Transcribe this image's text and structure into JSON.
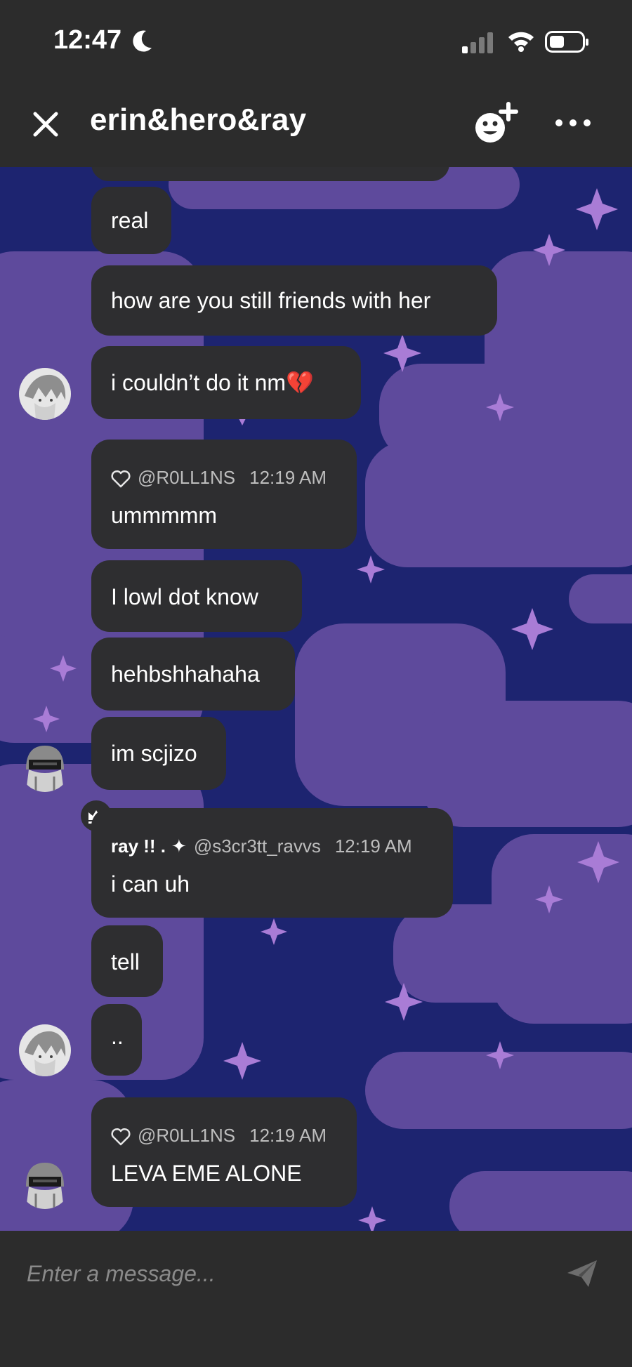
{
  "status_bar": {
    "time": "12:47"
  },
  "header": {
    "title": "erin&hero&ray"
  },
  "messages": [
    {
      "text": "real"
    },
    {
      "text": "how are you still friends with her"
    },
    {
      "text": "i couldn’t do it nm💔"
    },
    {
      "reply_to": "@R0LL1NS",
      "reply_time": "12:19 AM",
      "text": "ummmmm"
    },
    {
      "text": "I lowl dot know"
    },
    {
      "text": "hehbshhahaha"
    },
    {
      "text": "im scjizo"
    },
    {
      "sender_name": "ray !! .",
      "sender_badge": "✦",
      "sender_handle": "@s3cr3tt_ravvs",
      "time": "12:19 AM",
      "text": "i can uh"
    },
    {
      "text": "tell"
    },
    {
      "text": ".."
    },
    {
      "reply_to": "@R0LL1NS",
      "reply_time": "12:19 AM",
      "text": "LEVA EME ALONE"
    }
  ],
  "input": {
    "placeholder": "Enter a message..."
  },
  "colors": {
    "background": "#1d2470",
    "cloud": "#5e4a9c",
    "bubble": "#2e2e30",
    "bars": "#2c2c2c"
  }
}
